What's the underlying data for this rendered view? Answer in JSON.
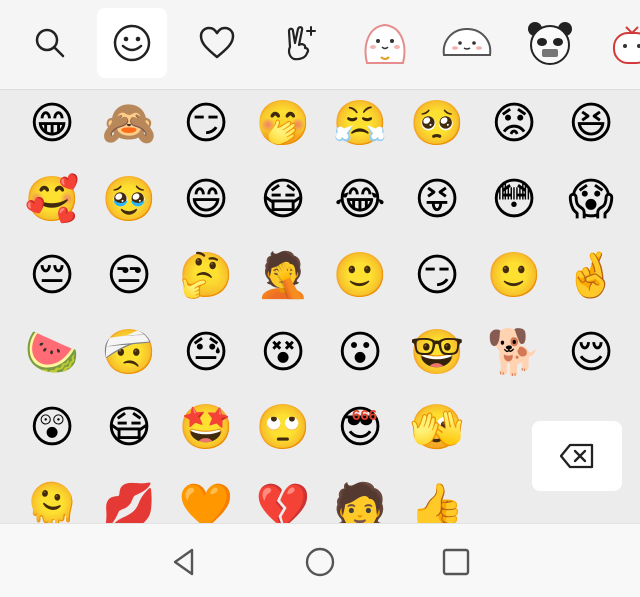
{
  "tabs": [
    {
      "name": "search",
      "icon": "search-icon"
    },
    {
      "name": "emoji",
      "icon": "smiley-icon",
      "active": true
    },
    {
      "name": "favorites",
      "icon": "heart-icon"
    },
    {
      "name": "gestures",
      "icon": "victory-hand-icon"
    },
    {
      "name": "sticker-cat",
      "icon": "cat-sticker-icon"
    },
    {
      "name": "sticker-bun",
      "icon": "bun-sticker-icon"
    },
    {
      "name": "sticker-panda",
      "icon": "panda-sticker-icon"
    },
    {
      "name": "sticker-more",
      "icon": "gift-sticker-icon"
    }
  ],
  "emoji_rows": [
    [
      "😁",
      "🙈",
      "😏",
      "🤭",
      "😤",
      "🥺",
      "😟",
      "😆"
    ],
    [
      "🥰",
      "🥹",
      "😄",
      "😷",
      "😂",
      "😝",
      "😳",
      "😱"
    ],
    [
      "😔",
      "😒",
      "🤔",
      "🤦",
      "🙂",
      "😏",
      "🙂",
      "🤞"
    ],
    [
      "🍉",
      "🤕",
      "😓",
      "😵",
      "😮",
      "🤓",
      "🐕",
      "😌"
    ],
    [
      "😲",
      "😷",
      "🤩",
      "🙄",
      "😎",
      "🫣"
    ],
    [
      "🫠",
      "💋",
      "🧡",
      "💔",
      "🧑",
      "👍"
    ]
  ],
  "badge_666": "666",
  "colors": {
    "accent": "#f6b51c",
    "icon": "#222222",
    "nav": "#555555"
  }
}
